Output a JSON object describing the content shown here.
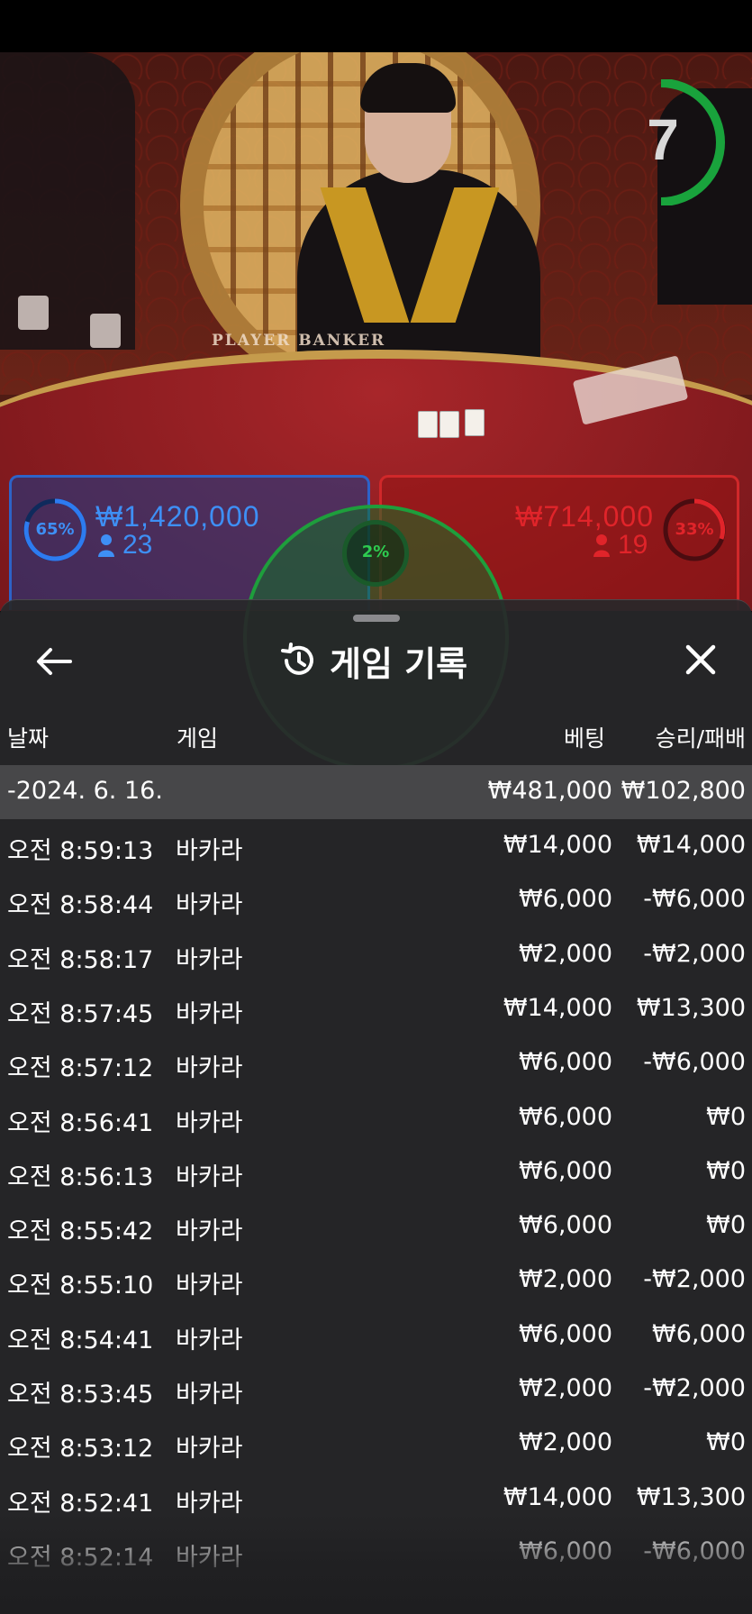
{
  "video": {
    "timer": "7",
    "table_label": "PLAYER BANKER",
    "player": {
      "percent": "65%",
      "amount": "₩1,420,000",
      "players": "23"
    },
    "banker": {
      "percent": "33%",
      "amount": "₩714,000",
      "players": "19"
    },
    "tie": {
      "percent": "2%"
    }
  },
  "history": {
    "title": "게임 기록",
    "columns": {
      "date": "날짜",
      "game": "게임",
      "bet": "베팅",
      "result": "승리/패배"
    },
    "day": {
      "date": "-2024. 6. 16.",
      "bet": "₩481,000",
      "result": "₩102,800"
    },
    "rows": [
      {
        "time": "오전 8:59:13",
        "game": "바카라",
        "bet": "₩14,000",
        "result": "₩14,000"
      },
      {
        "time": "오전 8:58:44",
        "game": "바카라",
        "bet": "₩6,000",
        "result": "-₩6,000"
      },
      {
        "time": "오전 8:58:17",
        "game": "바카라",
        "bet": "₩2,000",
        "result": "-₩2,000"
      },
      {
        "time": "오전 8:57:45",
        "game": "바카라",
        "bet": "₩14,000",
        "result": "₩13,300"
      },
      {
        "time": "오전 8:57:12",
        "game": "바카라",
        "bet": "₩6,000",
        "result": "-₩6,000"
      },
      {
        "time": "오전 8:56:41",
        "game": "바카라",
        "bet": "₩6,000",
        "result": "₩0"
      },
      {
        "time": "오전 8:56:13",
        "game": "바카라",
        "bet": "₩6,000",
        "result": "₩0"
      },
      {
        "time": "오전 8:55:42",
        "game": "바카라",
        "bet": "₩6,000",
        "result": "₩0"
      },
      {
        "time": "오전 8:55:10",
        "game": "바카라",
        "bet": "₩2,000",
        "result": "-₩2,000"
      },
      {
        "time": "오전 8:54:41",
        "game": "바카라",
        "bet": "₩6,000",
        "result": "₩6,000"
      },
      {
        "time": "오전 8:53:45",
        "game": "바카라",
        "bet": "₩2,000",
        "result": "-₩2,000"
      },
      {
        "time": "오전 8:53:12",
        "game": "바카라",
        "bet": "₩2,000",
        "result": "₩0"
      },
      {
        "time": "오전 8:52:41",
        "game": "바카라",
        "bet": "₩14,000",
        "result": "₩13,300"
      },
      {
        "time": "오전 8:52:14",
        "game": "바카라",
        "bet": "₩6,000",
        "result": "-₩6,000"
      }
    ]
  },
  "icons": {
    "back": "arrow-left-icon",
    "history": "history-icon",
    "close": "close-icon",
    "person": "person-icon"
  },
  "colors": {
    "player": "#2d63c8",
    "banker": "#d0282a",
    "tie": "#1e9e3c",
    "sheet": "#28282a",
    "date_row": "#474749"
  }
}
